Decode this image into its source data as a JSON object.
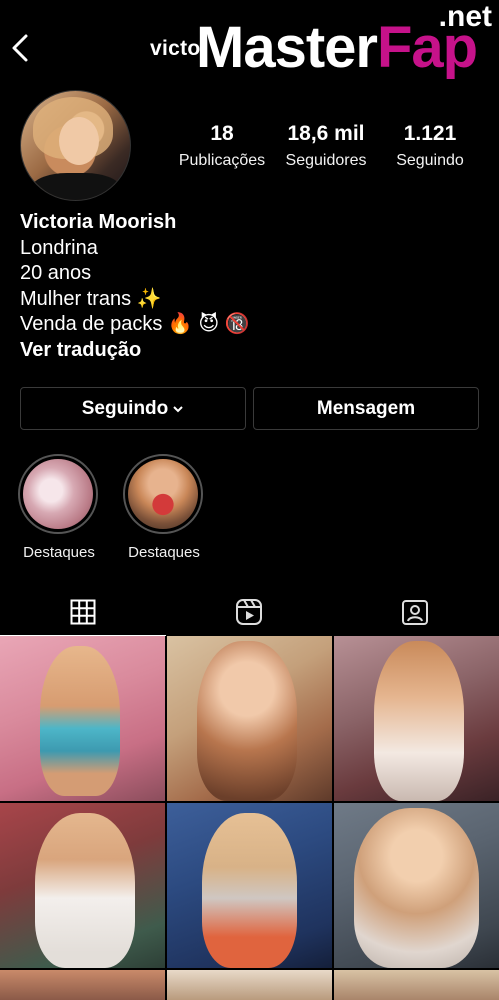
{
  "header": {
    "username": "victo",
    "watermark_master": "Master",
    "watermark_fap": "Fap",
    "watermark_net": ".net"
  },
  "profile": {
    "stats": [
      {
        "value": "18",
        "label": "Publicações"
      },
      {
        "value": "18,6 mil",
        "label": "Seguidores"
      },
      {
        "value": "1.121",
        "label": "Seguindo"
      }
    ],
    "bio": {
      "name": "Victoria Moorish",
      "city": "Londrina",
      "age": "20 anos",
      "line3": "Mulher trans ✨",
      "line4": "Venda de packs 🔥 😈 🔞",
      "translate": "Ver tradução"
    }
  },
  "actions": {
    "following_label": "Seguindo",
    "message_label": "Mensagem"
  },
  "highlights": [
    {
      "label": "Destaques"
    },
    {
      "label": "Destaques"
    }
  ],
  "tabs": [
    {
      "icon": "grid-icon",
      "active": true
    },
    {
      "icon": "reels-icon",
      "active": false
    },
    {
      "icon": "tagged-icon",
      "active": false
    }
  ],
  "colors": {
    "background": "#000000",
    "border": "#3a3a3a",
    "watermark_accent": "#c6128a"
  }
}
